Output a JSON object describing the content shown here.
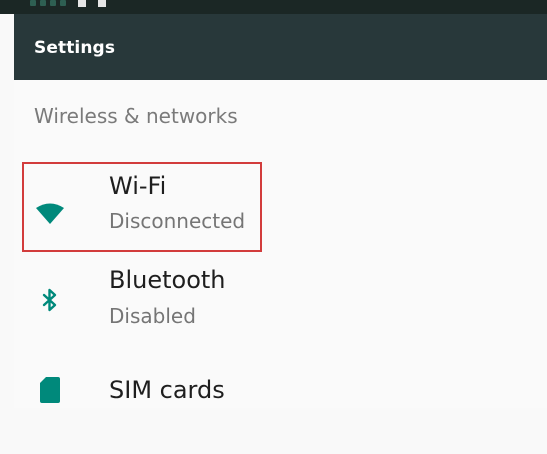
{
  "toolbar": {
    "title": "Settings"
  },
  "section": {
    "header": "Wireless & networks"
  },
  "items": [
    {
      "title": "Wi-Fi",
      "subtitle": "Disconnected",
      "icon": "wifi-icon"
    },
    {
      "title": "Bluetooth",
      "subtitle": "Disabled",
      "icon": "bluetooth-icon"
    },
    {
      "title": "SIM cards",
      "icon": "sim-card-icon"
    }
  ],
  "colors": {
    "accent": "#00897b",
    "toolbar": "#28383a",
    "highlight": "#d23c3c"
  }
}
